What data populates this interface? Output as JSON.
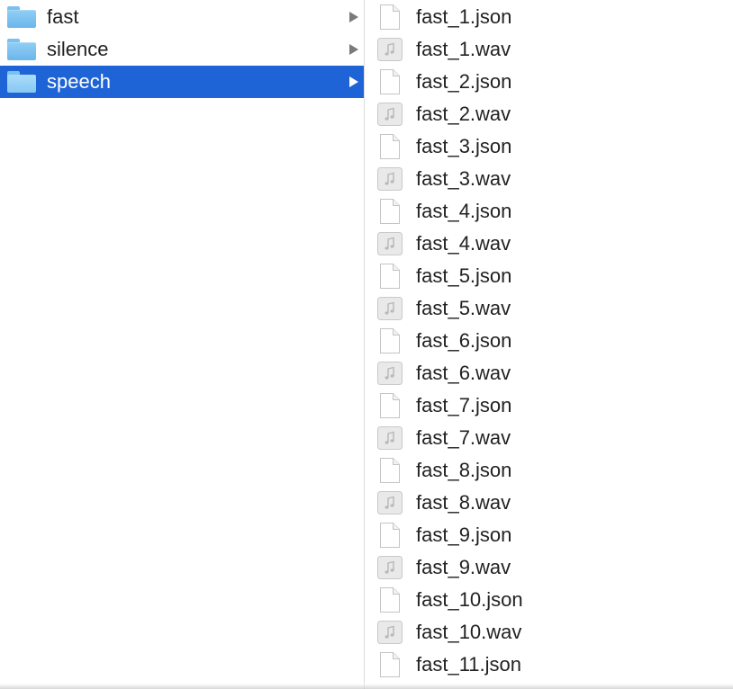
{
  "folders": [
    {
      "label": "fast",
      "icon": "folder-icon",
      "selected": false
    },
    {
      "label": "silence",
      "icon": "folder-icon",
      "selected": false
    },
    {
      "label": "speech",
      "icon": "folder-icon",
      "selected": true
    }
  ],
  "files": [
    {
      "label": "fast_1.json",
      "icon": "document-icon"
    },
    {
      "label": "fast_1.wav",
      "icon": "audio-file-icon"
    },
    {
      "label": "fast_2.json",
      "icon": "document-icon"
    },
    {
      "label": "fast_2.wav",
      "icon": "audio-file-icon"
    },
    {
      "label": "fast_3.json",
      "icon": "document-icon"
    },
    {
      "label": "fast_3.wav",
      "icon": "audio-file-icon"
    },
    {
      "label": "fast_4.json",
      "icon": "document-icon"
    },
    {
      "label": "fast_4.wav",
      "icon": "audio-file-icon"
    },
    {
      "label": "fast_5.json",
      "icon": "document-icon"
    },
    {
      "label": "fast_5.wav",
      "icon": "audio-file-icon"
    },
    {
      "label": "fast_6.json",
      "icon": "document-icon"
    },
    {
      "label": "fast_6.wav",
      "icon": "audio-file-icon"
    },
    {
      "label": "fast_7.json",
      "icon": "document-icon"
    },
    {
      "label": "fast_7.wav",
      "icon": "audio-file-icon"
    },
    {
      "label": "fast_8.json",
      "icon": "document-icon"
    },
    {
      "label": "fast_8.wav",
      "icon": "audio-file-icon"
    },
    {
      "label": "fast_9.json",
      "icon": "document-icon"
    },
    {
      "label": "fast_9.wav",
      "icon": "audio-file-icon"
    },
    {
      "label": "fast_10.json",
      "icon": "document-icon"
    },
    {
      "label": "fast_10.wav",
      "icon": "audio-file-icon"
    },
    {
      "label": "fast_11.json",
      "icon": "document-icon"
    }
  ],
  "colors": {
    "selection": "#1f64d6",
    "folder": "#7cc0ef",
    "text": "#222222"
  }
}
